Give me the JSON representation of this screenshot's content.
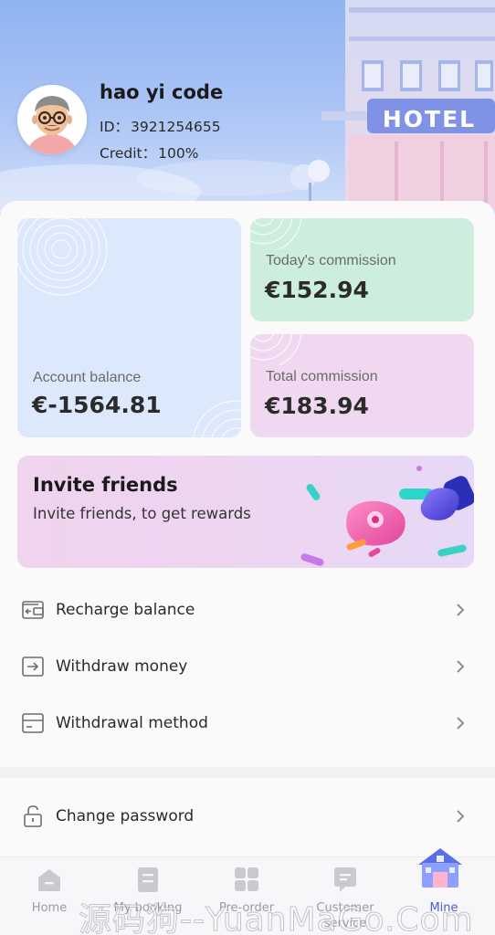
{
  "profile": {
    "name": "hao yi code",
    "id_label": "ID：",
    "id_value": "3921254655",
    "credit_label": "Credit：",
    "credit_value": "100%"
  },
  "hero": {
    "sign_text": "HOTEL"
  },
  "stats": {
    "balance": {
      "title": "Account balance",
      "value": "€-1564.81"
    },
    "today": {
      "title": "Today's commission",
      "value": "€152.94"
    },
    "total": {
      "title": "Total commission",
      "value": "€183.94"
    }
  },
  "invite": {
    "title": "Invite friends",
    "subtitle": "Invite friends, to get rewards"
  },
  "menu": [
    {
      "label": "Recharge balance",
      "icon": "wallet-icon"
    },
    {
      "label": "Withdraw money",
      "icon": "withdraw-icon"
    },
    {
      "label": "Withdrawal method",
      "icon": "card-icon"
    },
    {
      "label": "Change password",
      "icon": "lock-icon"
    }
  ],
  "tabs": [
    {
      "label": "Home",
      "icon": "home-icon"
    },
    {
      "label": "My booking",
      "icon": "booking-icon"
    },
    {
      "label": "Pre-order",
      "icon": "grid-icon"
    },
    {
      "label": "Customer service",
      "icon": "chat-icon"
    },
    {
      "label": "Mine",
      "icon": "hotel-house-icon",
      "active": true
    }
  ],
  "watermark": "源码狗--YuanMaGo.Com",
  "colors": {
    "accent": "#4a5bd4",
    "balance_card": "#dce8fb",
    "today_card": "#cdeedd",
    "total_card": "#f0d9f0",
    "invite_card": "#f0d3ee"
  }
}
